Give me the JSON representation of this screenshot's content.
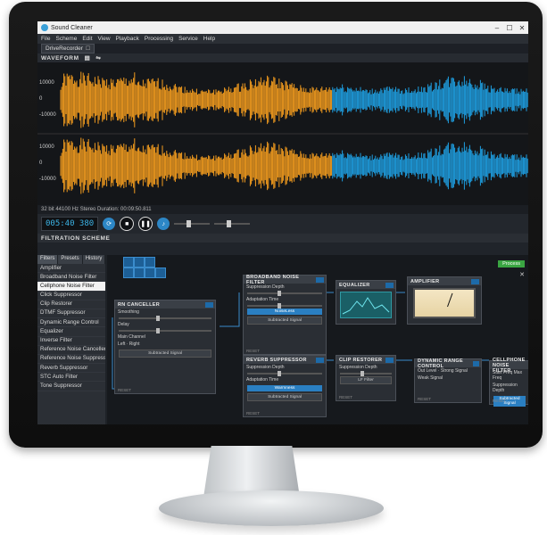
{
  "window": {
    "title": "Sound Cleaner"
  },
  "menu": [
    "File",
    "Scheme",
    "Edit",
    "View",
    "Playback",
    "Processing",
    "Service",
    "Help"
  ],
  "doc_tab": {
    "label": "DriveRecorder"
  },
  "waveform": {
    "header": "WAVEFORM",
    "y_labels": [
      "10000",
      "0",
      "-10000",
      "10000",
      "0",
      "-10000"
    ],
    "info": "32 bit 44100 Hz Stereo Duration: 00:09:50.811",
    "colors": {
      "processed": "#f39c1e",
      "original": "#1e9ee0"
    }
  },
  "transport": {
    "time": "005:40 380"
  },
  "filtration": {
    "header": "FILTRATION SCHEME",
    "panel_tabs": [
      "Filters",
      "Presets",
      "History"
    ],
    "filters": [
      "Amplifier",
      "Broadband Noise Filter",
      "Cellphone Noise Filter",
      "Click Suppressor",
      "Clip Restorer",
      "DTMF Suppressor",
      "Dynamic Range Control",
      "Equalizer",
      "Inverse Filter",
      "Reference Noise Canceller",
      "Reference Noise Suppressor",
      "Reverb Suppressor",
      "STC Auto Filter",
      "Tone Suppressor"
    ],
    "selected_filter": "Cellphone Noise Filter",
    "apply_label": "Process"
  },
  "nodes": {
    "rn": {
      "title": "RN CANCELLER",
      "l1": "Smoothing",
      "l2": "Delay",
      "l3": "Main Channel",
      "opt1": "Left",
      "opt2": "Right",
      "btn": "Subtracted Signal",
      "reset": "RESET"
    },
    "bb": {
      "title": "BROADBAND NOISE FILTER",
      "l1": "Suppression Depth",
      "l2": "Adaptation Time",
      "btn": "NoiseLess",
      "btn2": "Subtracted Signal",
      "reset": "RESET"
    },
    "eq": {
      "title": "EQUALIZER"
    },
    "amp": {
      "title": "AMPLIFIER"
    },
    "rv": {
      "title": "REVERB SUPPRESSOR",
      "l1": "Suppression Depth",
      "l2": "Adaptation Time",
      "btn": "Warmness",
      "btn2": "Subtracted Signal",
      "reset": "RESET"
    },
    "cr": {
      "title": "CLIP RESTORER",
      "l1": "Suppression Depth",
      "btn": "LF Filter",
      "reset": "RESET"
    },
    "dr": {
      "title": "DYNAMIC RANGE CONTROL",
      "l1": "Out Level",
      "l2": "Strong Signal",
      "l3": "Weak Signal",
      "reset": "RESET"
    },
    "cp": {
      "title": "CELLPHONE NOISE FILTER",
      "l1": "Start Freq",
      "l2": "Max Freq",
      "l3": "Suppression Depth",
      "btn": "Subtracted Signal",
      "reset": "RESET"
    }
  }
}
